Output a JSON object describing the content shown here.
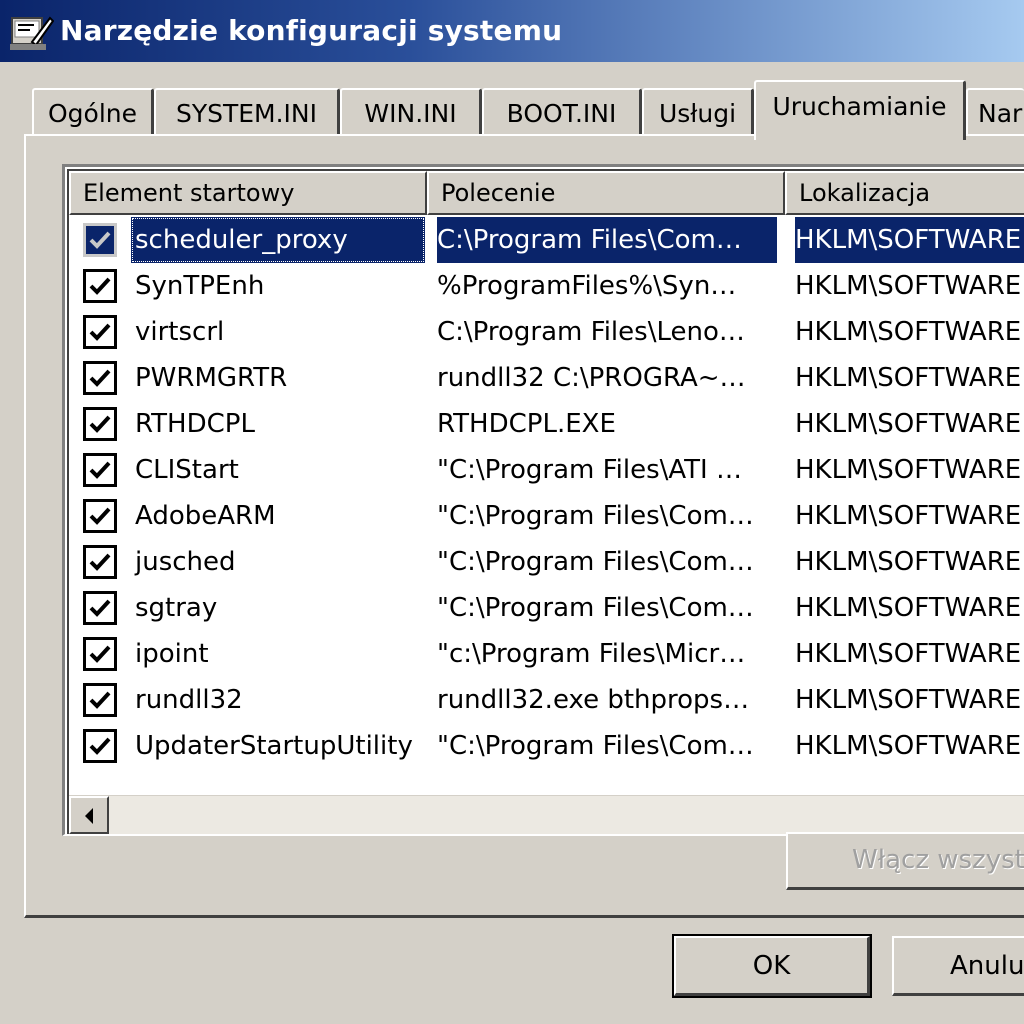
{
  "window": {
    "title": "Narzędzie konfiguracji systemu"
  },
  "tabs": [
    {
      "label": "Ogólne"
    },
    {
      "label": "SYSTEM.INI"
    },
    {
      "label": "WIN.INI"
    },
    {
      "label": "BOOT.INI"
    },
    {
      "label": "Usługi"
    },
    {
      "label": "Uruchamianie"
    },
    {
      "label": "Nar"
    }
  ],
  "active_tab": "Uruchamianie",
  "list": {
    "columns": [
      "Element startowy",
      "Polecenie",
      "Lokalizacja"
    ],
    "rows": [
      {
        "name": "scheduler_proxy",
        "command": "C:\\Program Files\\Com…",
        "location": "HKLM\\SOFTWARE",
        "checked": true
      },
      {
        "name": "SynTPEnh",
        "command": "%ProgramFiles%\\Syn…",
        "location": "HKLM\\SOFTWARE",
        "checked": true
      },
      {
        "name": "virtscrl",
        "command": "C:\\Program Files\\Leno…",
        "location": "HKLM\\SOFTWARE",
        "checked": true
      },
      {
        "name": "PWRMGRTR",
        "command": "rundll32 C:\\PROGRA~…",
        "location": "HKLM\\SOFTWARE",
        "checked": true
      },
      {
        "name": "RTHDCPL",
        "command": "RTHDCPL.EXE",
        "location": "HKLM\\SOFTWARE",
        "checked": true
      },
      {
        "name": "CLIStart",
        "command": "\"C:\\Program Files\\ATI …",
        "location": "HKLM\\SOFTWARE",
        "checked": true
      },
      {
        "name": "AdobeARM",
        "command": "\"C:\\Program Files\\Com…",
        "location": "HKLM\\SOFTWARE",
        "checked": true
      },
      {
        "name": "jusched",
        "command": "\"C:\\Program Files\\Com…",
        "location": "HKLM\\SOFTWARE",
        "checked": true
      },
      {
        "name": "sgtray",
        "command": "\"C:\\Program Files\\Com…",
        "location": "HKLM\\SOFTWARE",
        "checked": true
      },
      {
        "name": "ipoint",
        "command": "\"c:\\Program Files\\Micr…",
        "location": "HKLM\\SOFTWARE",
        "checked": true
      },
      {
        "name": "rundll32",
        "command": "rundll32.exe bthprops…",
        "location": "HKLM\\SOFTWARE",
        "checked": true
      },
      {
        "name": "UpdaterStartupUtility",
        "command": "\"C:\\Program Files\\Com…",
        "location": "HKLM\\SOFTWARE",
        "checked": true
      }
    ],
    "selected_row": "scheduler_proxy"
  },
  "buttons": {
    "enable_all": "Włącz wszyst",
    "ok": "OK",
    "cancel": "Anulu"
  },
  "icons": {
    "app": "msconfig-app-icon",
    "check": "check-mark-icon",
    "scroll_left": "arrow-left-icon"
  }
}
